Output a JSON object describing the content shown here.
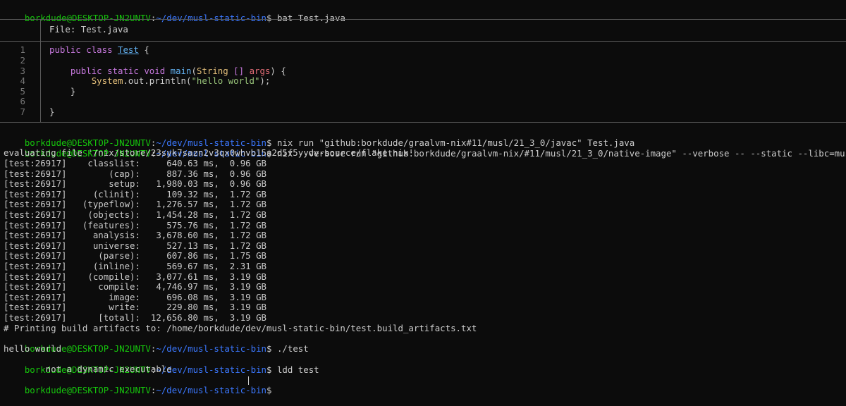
{
  "prompt": {
    "user": "borkdude@DESKTOP-JN2UNTV",
    "sep": ":",
    "path": "~/dev/musl-static-bin",
    "dollar": "$"
  },
  "commands": {
    "bat": " bat Test.java",
    "nix_javac": " nix run \"github:borkdude/graalvm-nix#11/musl/21_3_0/javac\" Test.java",
    "nix_native": " nix --verbose run \"github:borkdude/graalvm-nix/#11/musl/21_3_0/native-image\" --verbose -- --static --libc=musl Test",
    "run_test": " ./test",
    "ldd": " ldd test"
  },
  "bat": {
    "file_header": "File: Test.java",
    "line_numbers": [
      "1",
      "2",
      "3",
      "4",
      "5",
      "6",
      "7"
    ],
    "code": {
      "l1_public": "public",
      "l1_class": "class",
      "l1_name": "Test",
      "l1_brace": " {",
      "l3_indent": "    ",
      "l3_public": "public",
      "l3_static": "static",
      "l3_void": "void",
      "l3_main": "main",
      "l3_paren_open": "(",
      "l3_string": "String",
      "l3_brackets": "[]",
      "l3_args": "args",
      "l3_rest": ") {",
      "l4_indent": "        ",
      "l4_system": "System",
      "l4_call": ".out.println(",
      "l4_str": "\"hello world\"",
      "l4_end": ");",
      "l5": "    }",
      "l7": "}"
    }
  },
  "output": {
    "evaluating": "evaluating file '/nix/store/23syk7sazn2v3qx0whvb15a2d5f5yydv-source/flake.nix'",
    "build_lines": [
      "[test:26917]    classlist:     640.63 ms,  0.96 GB",
      "[test:26917]        (cap):     887.36 ms,  0.96 GB",
      "[test:26917]        setup:   1,980.03 ms,  0.96 GB",
      "[test:26917]     (clinit):     109.32 ms,  1.72 GB",
      "[test:26917]   (typeflow):   1,276.57 ms,  1.72 GB",
      "[test:26917]    (objects):   1,454.28 ms,  1.72 GB",
      "[test:26917]   (features):     575.76 ms,  1.72 GB",
      "[test:26917]     analysis:   3,678.60 ms,  1.72 GB",
      "[test:26917]     universe:     527.13 ms,  1.72 GB",
      "[test:26917]      (parse):     607.86 ms,  1.75 GB",
      "[test:26917]     (inline):     569.67 ms,  2.31 GB",
      "[test:26917]    (compile):   3,077.61 ms,  3.19 GB",
      "[test:26917]      compile:   4,746.97 ms,  3.19 GB",
      "[test:26917]        image:     696.08 ms,  3.19 GB",
      "[test:26917]        write:     229.80 ms,  3.19 GB",
      "[test:26917]      [total]:  12,656.80 ms,  3.19 GB"
    ],
    "artifacts": "# Printing build artifacts to: /home/borkdude/dev/musl-static-bin/test.build_artifacts.txt",
    "hello": "hello world",
    "ldd_result": "        not a dynamic executable"
  }
}
